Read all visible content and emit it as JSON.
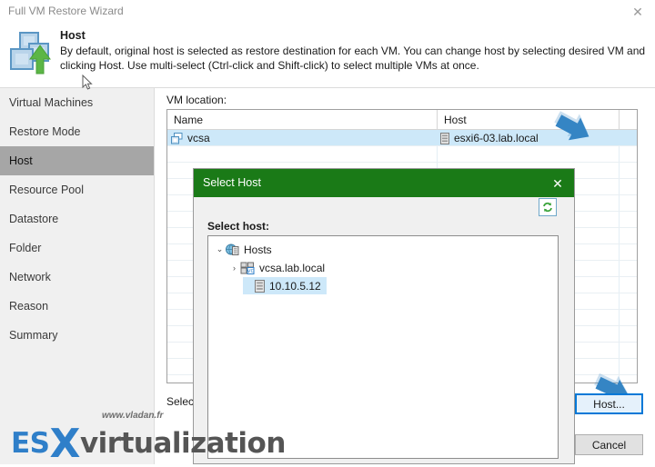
{
  "window": {
    "title": "Full VM Restore Wizard",
    "close_label": "✕"
  },
  "header": {
    "icon": "vm-restore-icon",
    "title": "Host",
    "description": "By default, original host is selected as restore destination for each VM. You can change host by selecting desired VM and clicking Host. Use multi-select (Ctrl-click and Shift-click) to select multiple VMs at once."
  },
  "sidebar": {
    "items": [
      {
        "label": "Virtual Machines",
        "active": false
      },
      {
        "label": "Restore Mode",
        "active": false
      },
      {
        "label": "Host",
        "active": true
      },
      {
        "label": "Resource Pool",
        "active": false
      },
      {
        "label": "Datastore",
        "active": false
      },
      {
        "label": "Folder",
        "active": false
      },
      {
        "label": "Network",
        "active": false
      },
      {
        "label": "Reason",
        "active": false
      },
      {
        "label": "Summary",
        "active": false
      }
    ]
  },
  "main": {
    "vm_location_label": "VM location:",
    "columns": [
      "Name",
      "Host"
    ],
    "rows": [
      {
        "name": "vcsa",
        "host": "esxi6-03.lab.local",
        "selected": true,
        "name_icon": "vm-icon",
        "host_icon": "esxi-host-icon"
      }
    ],
    "select_label": "Select"
  },
  "buttons": {
    "host": "Host...",
    "cancel": "Cancel"
  },
  "dialog": {
    "title": "Select Host",
    "close_label": "✕",
    "select_host_label": "Select host:",
    "refresh_icon": "refresh-icon",
    "tree": [
      {
        "label": "Hosts",
        "level": 0,
        "expander": "⌄",
        "expanded": true,
        "icon": "hosts-root-icon",
        "selected": false
      },
      {
        "label": "vcsa.lab.local",
        "level": 1,
        "expander": "›",
        "expanded": false,
        "icon": "vcenter-icon",
        "selected": false
      },
      {
        "label": "10.10.5.12",
        "level": 2,
        "expander": "",
        "expanded": false,
        "icon": "esxi-host-icon",
        "selected": true
      }
    ]
  },
  "annotations": {
    "arrow_host_column": "blue-arrow-pointing-to-host-cell",
    "arrow_tree_item": "blue-arrow-pointing-to-selected-host",
    "arrow_host_button": "blue-arrow-pointing-to-host-button"
  },
  "watermark": {
    "url": "www.vladan.fr",
    "prefix": "ES",
    "mark": "X",
    "suffix": "virtualization"
  },
  "colors": {
    "dialog_header_green": "#1a7a17",
    "selection_blue": "#cde8f9",
    "accent_blue": "#0078d7",
    "annotation_blue": "#2e7ebd",
    "sidebar_bg": "#f0f0f0",
    "active_sidebar": "#a6a6a6"
  }
}
